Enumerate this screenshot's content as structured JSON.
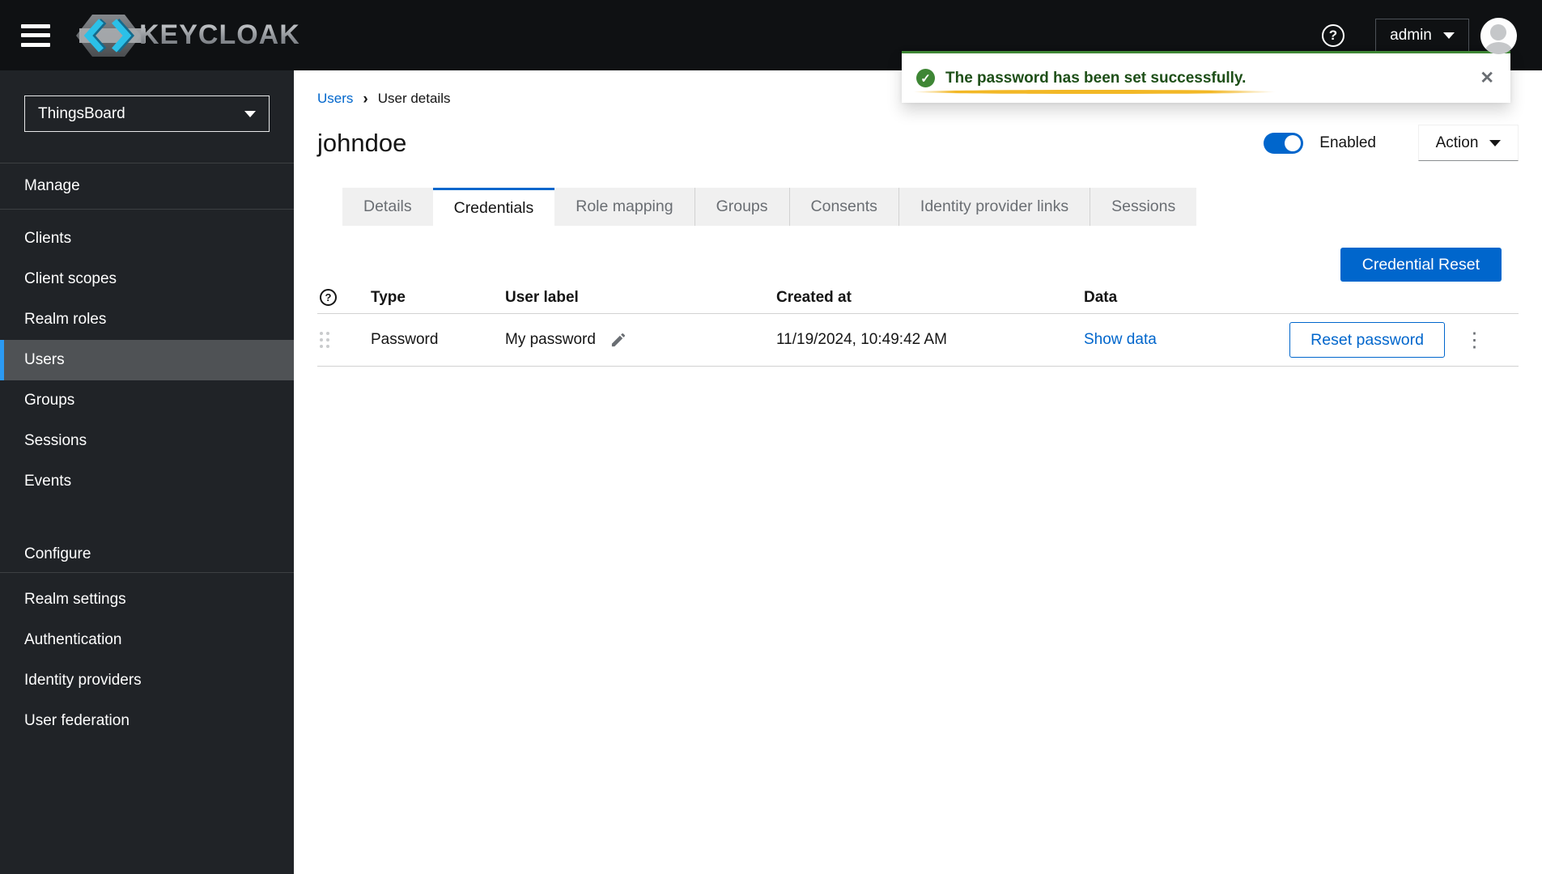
{
  "masthead": {
    "brand": "KEYCLOAK",
    "username": "admin"
  },
  "icons": {
    "help": "?",
    "close": "✕",
    "check": "✓",
    "kebab": "⋮",
    "breadcrumb_separator": "›"
  },
  "toast": {
    "message": "The password has been set successfully."
  },
  "sidebar": {
    "realm_selector": "ThingsBoard",
    "sections": [
      {
        "label": "Manage",
        "items": [
          {
            "label": "Clients",
            "active": false
          },
          {
            "label": "Client scopes",
            "active": false
          },
          {
            "label": "Realm roles",
            "active": false
          },
          {
            "label": "Users",
            "active": true
          },
          {
            "label": "Groups",
            "active": false
          },
          {
            "label": "Sessions",
            "active": false
          },
          {
            "label": "Events",
            "active": false
          }
        ]
      },
      {
        "label": "Configure",
        "items": [
          {
            "label": "Realm settings",
            "active": false
          },
          {
            "label": "Authentication",
            "active": false
          },
          {
            "label": "Identity providers",
            "active": false
          },
          {
            "label": "User federation",
            "active": false
          }
        ]
      }
    ]
  },
  "breadcrumb": {
    "parent": "Users",
    "current": "User details"
  },
  "page": {
    "title": "johndoe",
    "enabled_label": "Enabled",
    "action_label": "Action"
  },
  "tabs": [
    {
      "label": "Details",
      "active": false
    },
    {
      "label": "Credentials",
      "active": true
    },
    {
      "label": "Role mapping",
      "active": false
    },
    {
      "label": "Groups",
      "active": false
    },
    {
      "label": "Consents",
      "active": false
    },
    {
      "label": "Identity provider links",
      "active": false
    },
    {
      "label": "Sessions",
      "active": false
    }
  ],
  "credentials": {
    "reset_button_label": "Credential Reset",
    "table": {
      "headers": {
        "type": "Type",
        "user_label": "User label",
        "created_at": "Created at",
        "data": "Data"
      },
      "rows": [
        {
          "type": "Password",
          "user_label": "My password",
          "created_at": "11/19/2024, 10:49:42 AM",
          "data_action": "Show data",
          "reset_action": "Reset password"
        }
      ]
    }
  },
  "colors": {
    "primary": "#0066cc",
    "success_border": "#3e8635",
    "success_text": "#1e4f18",
    "highlight": "#f0ab00",
    "nav_active_accent": "#2b9af3",
    "masthead_bg": "#0f1113",
    "sidebar_bg": "#202327"
  }
}
